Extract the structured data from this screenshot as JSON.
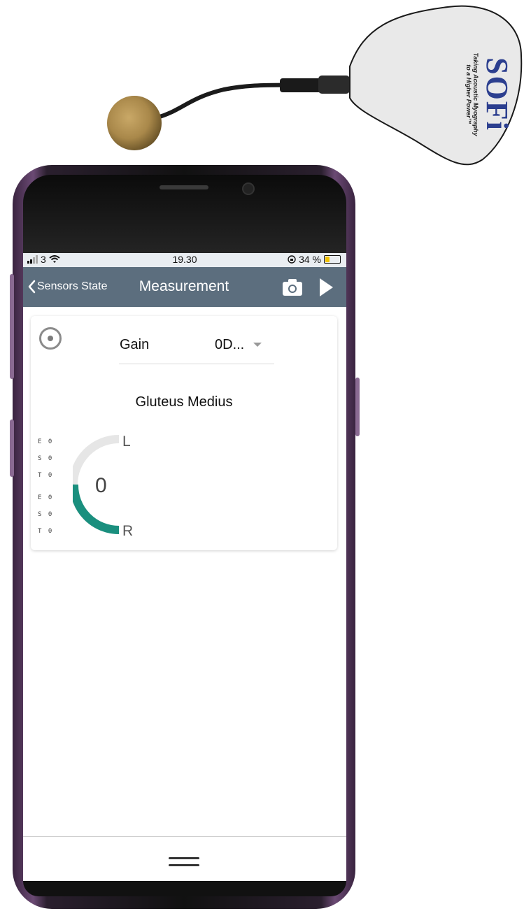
{
  "status_bar": {
    "carrier": "3",
    "time": "19.30",
    "battery": "34 %",
    "battery_level": 0.34,
    "icons": [
      "signal-icon",
      "wifi-icon",
      "rotation-lock-icon",
      "battery-icon"
    ]
  },
  "nav": {
    "back_label": "Sensors State",
    "title": "Measurement",
    "icons": [
      "chevron-left-icon",
      "camera-icon",
      "play-icon"
    ]
  },
  "card": {
    "gain_label": "Gain",
    "gain_value": "0D...",
    "muscle": "Gluteus Medius",
    "scale_top": [
      "E 0",
      "S 0",
      "T 0"
    ],
    "scale_bottom": [
      "E 0",
      "S 0",
      "T 0"
    ],
    "gauge_value": "0",
    "left_label": "L",
    "right_label": "R",
    "colors": {
      "gauge_track": "#e6e6e6",
      "gauge_fill": "#1a8f7e"
    }
  },
  "colors": {
    "navbar": "#5c6e7e",
    "status_bar": "#e9edf1"
  },
  "device": {
    "brand": "SOFi",
    "tagline": "Taking Acoustic Myography to a Higher Power™"
  }
}
